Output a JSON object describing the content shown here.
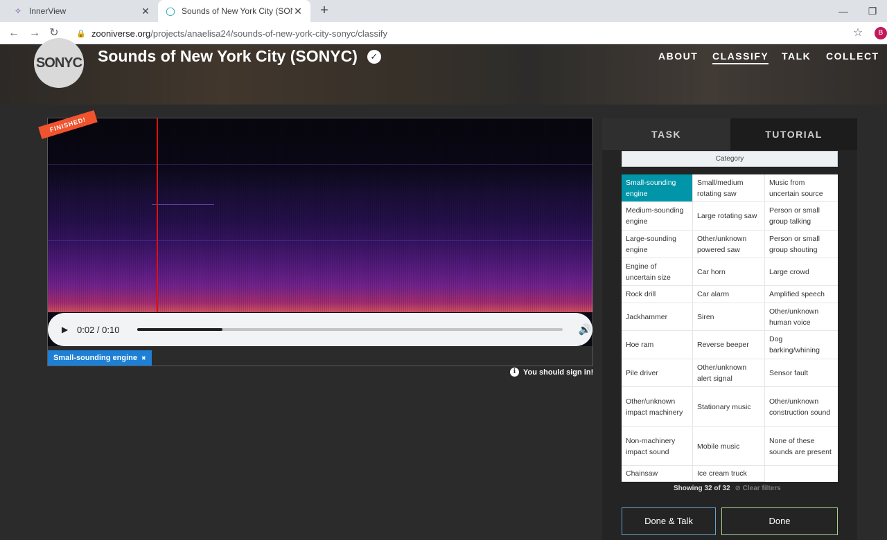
{
  "browser": {
    "tabs": [
      {
        "label": "InnerView",
        "icon": "innerview-icon"
      },
      {
        "label": "Sounds of New York City (SONYC",
        "icon": "zooniverse-icon"
      }
    ],
    "url_host": "zooniverse.org",
    "url_path": "/projects/anaelisa24/sounds-of-new-york-city-sonyc/classify",
    "profile_initial": "B"
  },
  "header": {
    "logo_text": "SONYC",
    "title": "Sounds of New York City (SONYC)",
    "nav": [
      {
        "label": "ABOUT",
        "active": false
      },
      {
        "label": "CLASSIFY",
        "active": true
      },
      {
        "label": "TALK",
        "active": false
      },
      {
        "label": "COLLECT",
        "active": false
      }
    ]
  },
  "viewer": {
    "ribbon": "FINISHED!",
    "playhead_fraction": 0.2,
    "audio": {
      "time": "0:02 / 0:10",
      "progress": 0.2
    },
    "selected_tag": "Small-sounding engine",
    "sign_in_notice": "You should sign in!"
  },
  "panel": {
    "tabs": [
      "TASK",
      "TUTORIAL"
    ],
    "category_header": "Category",
    "columns": [
      [
        "Small-sounding engine",
        "Medium-sounding engine",
        "Large-sounding engine",
        "Engine of uncertain size",
        "Rock drill",
        "Jackhammer",
        "Hoe ram",
        "Pile driver",
        "Other/unknown impact machinery",
        "Non-machinery impact sound",
        "Chainsaw"
      ],
      [
        "Small/medium rotating saw",
        "Large rotating saw",
        "Other/unknown powered saw",
        "Car horn",
        "Car alarm",
        "Siren",
        "Reverse beeper",
        "Other/unknown alert signal",
        "Stationary music",
        "Mobile music",
        "Ice cream truck"
      ],
      [
        "Music from uncertain source",
        "Person or small group talking",
        "Person or small group shouting",
        "Large crowd",
        "Amplified speech",
        "Other/unknown human voice",
        "Dog barking/whining",
        "Sensor fault",
        "Other/unknown construction sound",
        "None of these sounds are present"
      ]
    ],
    "selected": "Small-sounding engine",
    "showing": "Showing 32 of 32",
    "clear_filters": "Clear filters",
    "done_talk": "Done & Talk",
    "done": "Done"
  }
}
